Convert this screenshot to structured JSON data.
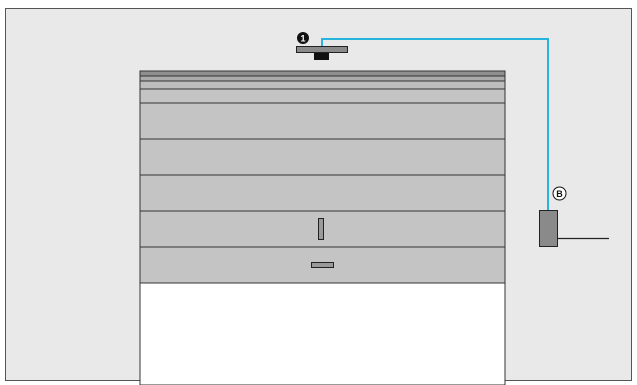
{
  "callouts": {
    "sensor": {
      "number": "1"
    },
    "receiver": {
      "letter": "B"
    }
  },
  "colors": {
    "frame_fill": "#e9e9e9",
    "frame_stroke": "#555555",
    "door_panel": "#c4c4c4",
    "door_line": "#333333",
    "opening": "#ffffff",
    "device": "#8a8a8a",
    "cable": "#27b4dc",
    "wire": "#222222"
  }
}
